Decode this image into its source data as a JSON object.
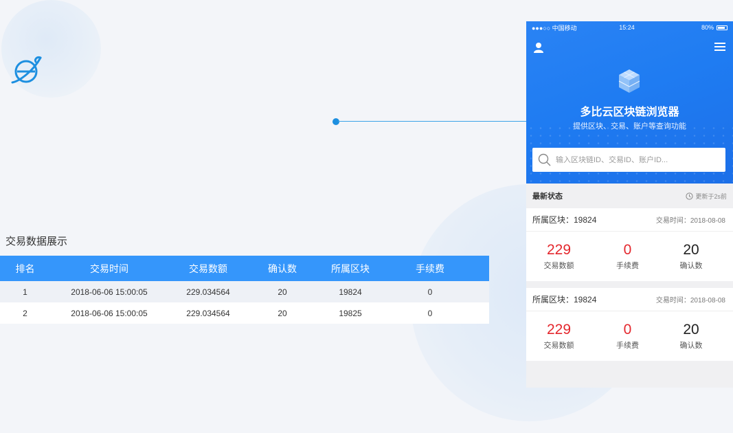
{
  "table_section": {
    "title": "交易数据展示",
    "columns": [
      "排名",
      "交易时间",
      "交易数额",
      "确认数",
      "所属区块",
      "手续费"
    ],
    "rows": [
      [
        "1",
        "2018-06-06 15:00:05",
        "229.034564",
        "20",
        "19824",
        "0"
      ],
      [
        "2",
        "2018-06-06 15:00:05",
        "229.034564",
        "20",
        "19825",
        "0"
      ]
    ]
  },
  "phone": {
    "status_bar": {
      "carrier": "●●●○○ 中国移动",
      "time": "15:24",
      "battery": "80%"
    },
    "app_title": "多比云区块链浏览器",
    "app_subtitle": "提供区块、交易、账户等查询功能",
    "search": {
      "placeholder": "输入区块链ID、交易ID、账户ID..."
    },
    "latest": {
      "title": "最新状态",
      "updated": "更新于2s前"
    },
    "cards": [
      {
        "block": "所属区块：19824",
        "time": "交易时间：2018-08-08",
        "stats": [
          {
            "value": "229",
            "label": "交易数额"
          },
          {
            "value": "0",
            "label": "手续费"
          },
          {
            "value": "20",
            "label": "确认数"
          }
        ]
      },
      {
        "block": "所属区块：19824",
        "time": "交易时间：2018-08-08",
        "stats": [
          {
            "value": "229",
            "label": "交易数额"
          },
          {
            "value": "0",
            "label": "手续费"
          },
          {
            "value": "20",
            "label": "确认数"
          }
        ]
      }
    ]
  },
  "colors": {
    "accent_blue": "#3596fb",
    "hero_blue": "#2a83f4",
    "value_red": "#e4272d",
    "background": "#f3f5f9"
  },
  "icons": [
    "planet-icon",
    "user-icon",
    "menu-icon",
    "blockchain-cube-icon",
    "search-icon",
    "clock-icon"
  ]
}
